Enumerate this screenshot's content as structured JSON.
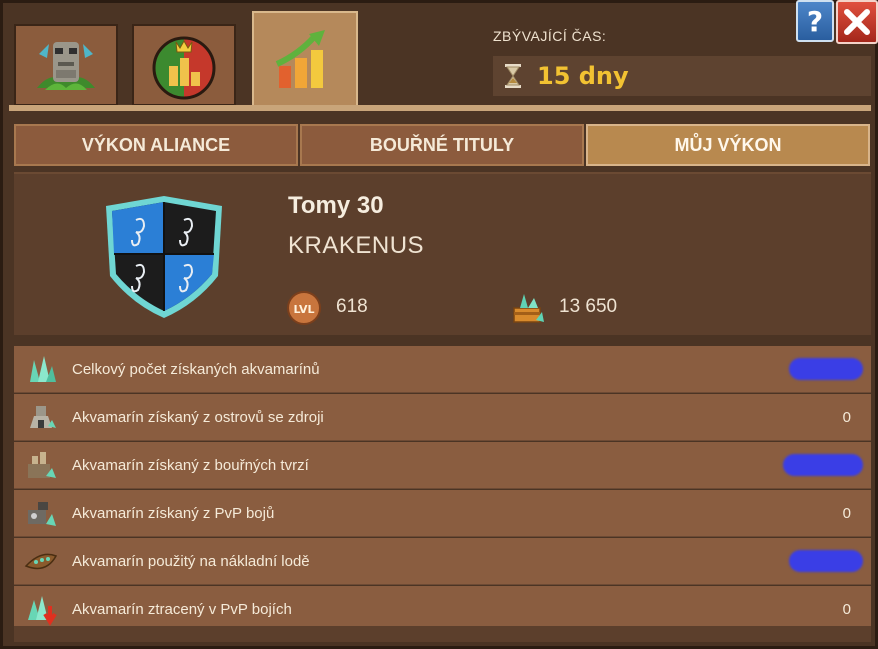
{
  "top_tabs": [
    {
      "name": "totem",
      "active": false
    },
    {
      "name": "rankings",
      "active": false
    },
    {
      "name": "performance",
      "active": true
    }
  ],
  "time": {
    "label": "ZBÝVAJÍCÍ ČAS:",
    "value": "15 dny"
  },
  "buttons": {
    "help": "?",
    "close": "close-icon"
  },
  "sub_tabs": [
    {
      "label": "VÝKON ALIANCE",
      "active": false
    },
    {
      "label": "BOUŘNÉ TITULY",
      "active": false
    },
    {
      "label": "MŮJ VÝKON",
      "active": true
    }
  ],
  "profile": {
    "player_name": "Tomy 30",
    "alliance_name": "KRAKENUS",
    "level_badge": "LVL",
    "level": "618",
    "aquamarine": "13 650"
  },
  "stats": [
    {
      "label": "Celkový počet získaných akvamarínů",
      "value": null,
      "redacted": true
    },
    {
      "label": "Akvamarín získaný z ostrovů se zdroji",
      "value": "0",
      "redacted": false
    },
    {
      "label": "Akvamarín získaný z bouřných tvrzí",
      "value": null,
      "redacted": true
    },
    {
      "label": "Akvamarín získaný z PvP bojů",
      "value": "0",
      "redacted": false
    },
    {
      "label": "Akvamarín použitý na nákladní lodě",
      "value": null,
      "redacted": true
    },
    {
      "label": "Akvamarín ztracený v PvP bojích",
      "value": "0",
      "redacted": false
    }
  ],
  "colors": {
    "accent_gold": "#f2c232",
    "panel": "#5c3f2c",
    "row": "#8a5d40",
    "redaction": "#3a3ee6"
  }
}
